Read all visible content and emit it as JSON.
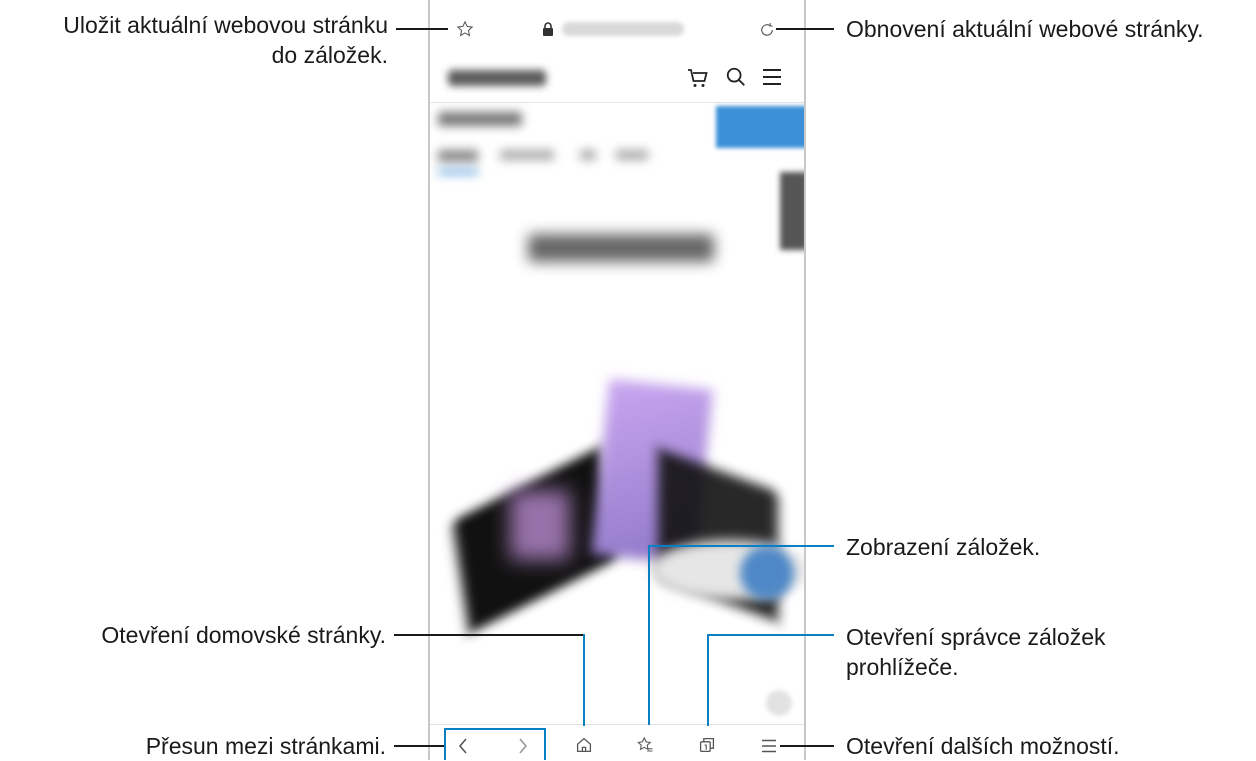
{
  "callouts": {
    "bookmark_save": "Uložit aktuální webovou stránku",
    "bookmark_save_line2": "do záložek.",
    "refresh": "Obnovení aktuální webové stránky.",
    "view_bookmarks": "Zobrazení záložek.",
    "home": "Otevření domovské stránky.",
    "tab_manager": "Otevření správce záložek",
    "tab_manager_line2": "prohlížeče.",
    "navigate": "Přesun mezi stránkami.",
    "more_options": "Otevření dalších možností."
  },
  "browser": {
    "icons": {
      "top": [
        "star-icon",
        "lock-icon",
        "refresh-icon"
      ],
      "header": [
        "cart-icon",
        "search-icon",
        "menu-icon"
      ],
      "bottom": [
        "back-icon",
        "forward-icon",
        "home-icon",
        "bookmarks-icon",
        "tabs-icon",
        "more-icon"
      ]
    }
  },
  "colors": {
    "callout_line": "#0a7fc4",
    "accent_button": "#3a8fd6"
  }
}
